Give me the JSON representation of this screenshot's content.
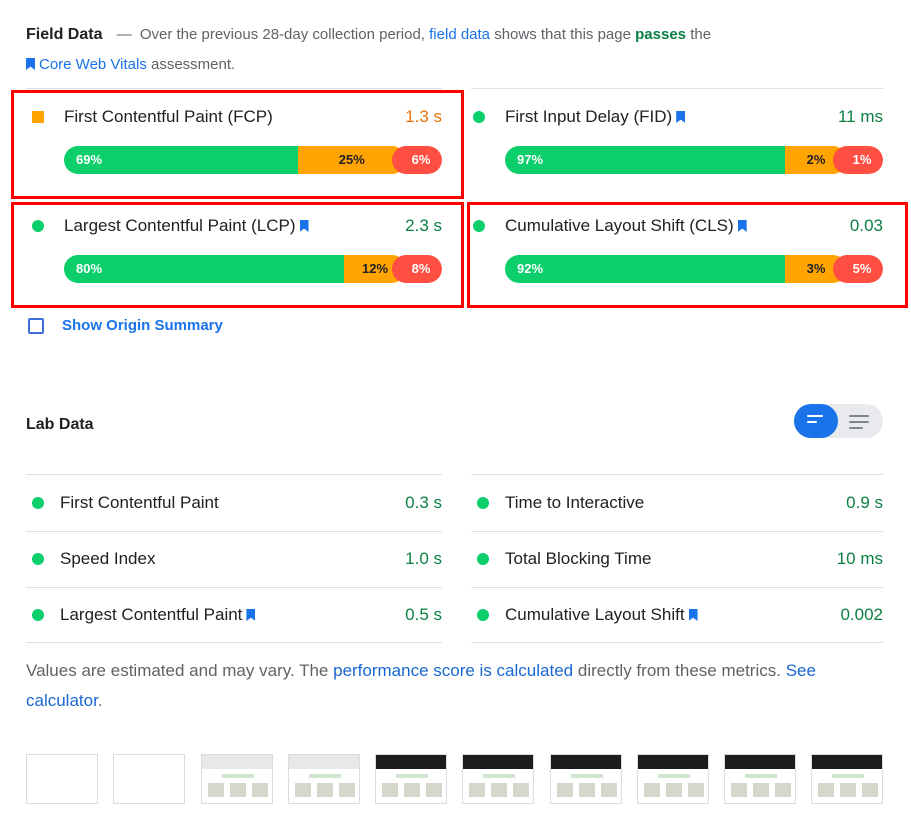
{
  "field": {
    "title": "Field Data",
    "dash": "—",
    "desc_1": "Over the previous 28-day collection period,",
    "field_link": "field data",
    "desc_2": "shows that this page",
    "passes": "passes",
    "desc_3": "the",
    "cwv_link": "Core Web Vitals",
    "desc_4": "assessment.",
    "metrics": [
      {
        "name": "First Contentful Paint (FCP)",
        "value": "1.3 s",
        "status_color": "#ffa400",
        "cwv": false,
        "dist": [
          {
            "label": "69%",
            "pct": 69
          },
          {
            "label": "25%",
            "pct": 25
          },
          {
            "label": "6%",
            "pct": 6
          }
        ]
      },
      {
        "name": "First Input Delay (FID)",
        "value": "11 ms",
        "status_color": "#0cce6b",
        "cwv": true,
        "dist": [
          {
            "label": "97%",
            "pct": 97
          },
          {
            "label": "2%",
            "pct": 2
          },
          {
            "label": "1%",
            "pct": 1
          }
        ]
      },
      {
        "name": "Largest Contentful Paint (LCP)",
        "value": "2.3 s",
        "status_color": "#0cce6b",
        "cwv": true,
        "dist": [
          {
            "label": "80%",
            "pct": 80
          },
          {
            "label": "12%",
            "pct": 12
          },
          {
            "label": "8%",
            "pct": 8
          }
        ]
      },
      {
        "name": "Cumulative Layout Shift (CLS)",
        "value": "0.03",
        "status_color": "#0cce6b",
        "cwv": true,
        "dist": [
          {
            "label": "92%",
            "pct": 92
          },
          {
            "label": "3%",
            "pct": 3
          },
          {
            "label": "5%",
            "pct": 5
          }
        ]
      }
    ],
    "value_colors": {
      "average": "#e8710a",
      "good": "#0b8043"
    }
  },
  "origin_summary": {
    "label": "Show Origin Summary",
    "checked": false
  },
  "lab": {
    "title": "Lab Data",
    "metrics": [
      {
        "name": "First Contentful Paint",
        "value": "0.3 s"
      },
      {
        "name": "Time to Interactive",
        "value": "0.9 s"
      },
      {
        "name": "Speed Index",
        "value": "1.0 s"
      },
      {
        "name": "Total Blocking Time",
        "value": "10 ms"
      },
      {
        "name": "Largest Contentful Paint",
        "value": "0.5 s"
      },
      {
        "name": "Cumulative Layout Shift",
        "value": "0.002"
      }
    ]
  },
  "note": {
    "text_1": "Values are estimated and may vary. The",
    "score_link": "performance score is calculated",
    "text_2": "directly from these metrics.",
    "calc_link": "See calculator",
    "text_3": "."
  },
  "filmstrip": {
    "frames": [
      "blank",
      "blank",
      "loading",
      "loading",
      "loaded",
      "loaded",
      "loaded",
      "loaded",
      "loaded",
      "loaded"
    ]
  }
}
